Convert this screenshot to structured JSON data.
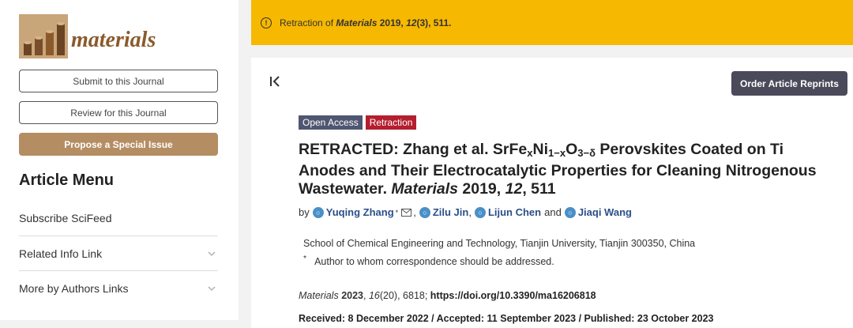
{
  "sidebar": {
    "logo_text": "materials",
    "submit_label": "Submit to this Journal",
    "review_label": "Review for this Journal",
    "propose_label": "Propose a Special Issue",
    "menu_title": "Article Menu",
    "menu_items": [
      {
        "label": "Subscribe SciFeed"
      },
      {
        "label": "Related Info Link"
      },
      {
        "label": "More by Authors Links"
      }
    ]
  },
  "banner": {
    "prefix": "Retraction of ",
    "journal": "Materials",
    "year": " 2019, ",
    "volume": "12",
    "rest": "(3), 511."
  },
  "toolbar": {
    "collapse_label": "|<",
    "reprints_label": "Order Article Reprints"
  },
  "article": {
    "badges": {
      "open_access": "Open Access",
      "retraction": "Retraction"
    },
    "title": {
      "part1": "RETRACTED: Zhang et al. SrFe",
      "sub1": "x",
      "part2": "Ni",
      "sub2": "1−x",
      "part3": "O",
      "sub3": "3−δ",
      "part4": " Perovskites Coated on Ti Anodes and Their Electrocatalytic Properties for Cleaning Nitrogenous Wastewater. ",
      "journal": "Materials",
      "year": " 2019, ",
      "volume": "12",
      "pages": ", 511"
    },
    "by_label": "by",
    "authors": [
      "Yuqing Zhang",
      "Zilu Jin",
      "Lijun Chen",
      "Jiaqi Wang"
    ],
    "and_label": "and",
    "affiliation": "School of Chemical Engineering and Technology, Tianjin University, Tianjin 300350, China",
    "correspondence": "Author to whom correspondence should be addressed.",
    "citation": {
      "journal": "Materials",
      "year": " 2023",
      "rest": ", ",
      "volume": "16",
      "issue_pages": "(20), 6818; ",
      "doi": "https://doi.org/10.3390/ma16206818"
    },
    "dates": "Received: 8 December 2022 / Accepted: 11 September 2023 / Published: 23 October 2023"
  }
}
